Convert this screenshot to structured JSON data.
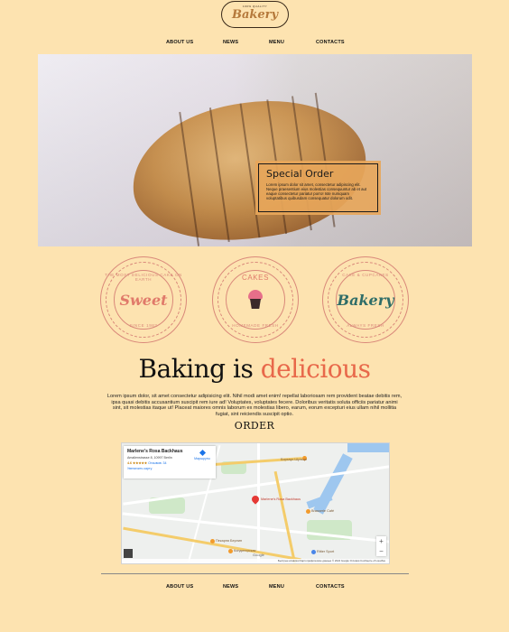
{
  "logo": {
    "tagline": "100% QUALITY",
    "wordmark": "Bakery"
  },
  "nav": [
    {
      "label": "ABOUT US"
    },
    {
      "label": "NEWS"
    },
    {
      "label": "MENU"
    },
    {
      "label": "CONTACTS"
    }
  ],
  "hero": {
    "card_title": "Special Order",
    "card_text": "Lorem ipsum dolor sit amet, consectetur adipiscing elit. Neque praesentium eius molestias consequuntur ab et aut eaque consectetur pariatur porro! Iste numquam voluptatibus quibusdam consequatur dolorum odit."
  },
  "badges": [
    {
      "top": "THE MOST DELICIOUS CAKE ON EARTH",
      "center": "Sweet",
      "bottom": "SINCE 1983",
      "accent": "#d9887a"
    },
    {
      "top": "CAKES",
      "center": "",
      "bottom": "HOMEMADE FRESH",
      "accent": "#d9887a"
    },
    {
      "top": "CAKE & CUPCAKES",
      "center": "Bakery",
      "bottom": "ALWAYS FRESH",
      "accent": "#d9887a"
    }
  ],
  "main": {
    "heading_plain": "Baking is ",
    "heading_accent": "delicious",
    "heading_accent_color": "#e8684a",
    "body": "Lorem ipsum dolor, sit amet consectetur adipisicing elit. Nihil modi amet enim! repellat laboriosam rem provident beatae debitis rem, ipsa quasi debitis accusantium suscipit rem iure ad! Voluptates, voluptates fecere. Doloribus veritatis soluta officiis pariatur animi sint, sit molestias itaque ut! Placeat maiores omnis laborum ex molestias libero, earum, eorum excepturi eius ullam nihil mollitia fugiat, sint reiciendis suscipit optio.",
    "order_label": "ORDER"
  },
  "map": {
    "place_name": "Marlene's Rosa Backhaus",
    "address": "Amalienstrasse 8, 10997 Berlin",
    "rating": "4.6",
    "stars": "★★★★★",
    "reviews": "Отзывов: 34",
    "larger_map": "Увеличить карту",
    "directions": "Маршруты",
    "pin_label": "Marlene's Rosa Backhaus",
    "labels": [
      "Бирхаус Шульце",
      "Brasserie Café",
      "Пекарня Берлин",
      "Кондитерская",
      "Ritter Sport"
    ],
    "zoom_in": "+",
    "zoom_out": "−",
    "footer": "Быстрые клавиши   Картографические данные © 2024 Google   Условия   Сообщить об ошибке",
    "google": "Google"
  }
}
